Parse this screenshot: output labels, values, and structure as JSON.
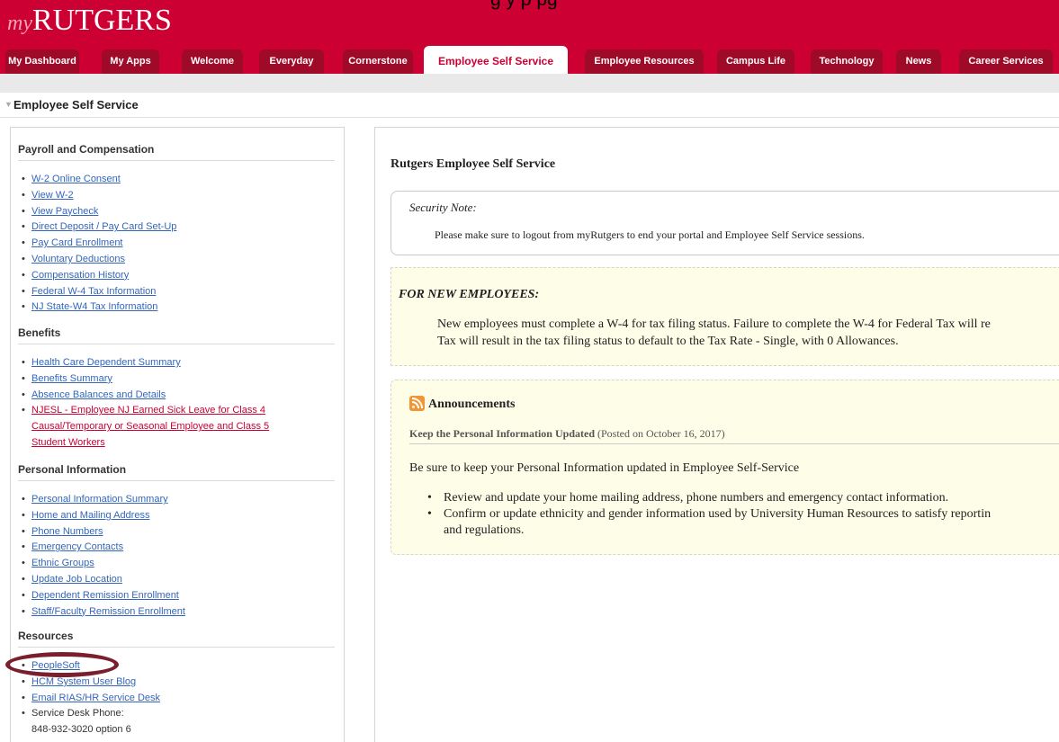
{
  "overlay_caption": "g y                 p                         pg",
  "logo": {
    "my": "my",
    "name": "RUTGERS"
  },
  "tabs": [
    {
      "label": "My Dashboard"
    },
    {
      "label": "My Apps"
    },
    {
      "label": "Welcome"
    },
    {
      "label": "Everyday"
    },
    {
      "label": "Cornerstone"
    },
    {
      "label": "Employee Self Service",
      "active": true
    },
    {
      "label": "Employee Resources"
    },
    {
      "label": "Campus Life"
    },
    {
      "label": "Technology"
    },
    {
      "label": "News"
    },
    {
      "label": "Career Services"
    }
  ],
  "section_title": "Employee Self Service",
  "left": {
    "payroll": {
      "title": "Payroll and Compensation",
      "links": [
        "W-2 Online Consent",
        "View W-2",
        "View Paycheck",
        "Direct Deposit / Pay Card Set-Up",
        "Pay Card Enrollment",
        "Voluntary Deductions",
        "Compensation History",
        "Federal W-4 Tax Information",
        "NJ State-W4 Tax Information"
      ]
    },
    "benefits": {
      "title": "Benefits",
      "links": [
        "Health Care Dependent Summary",
        "Benefits Summary",
        "Absence Balances and Details"
      ],
      "njesl": [
        "NJESL - Employee NJ Earned Sick Leave for Class 4",
        "Causal/Temporary or Seasonal Employee and Class 5",
        "Student Workers"
      ]
    },
    "personal": {
      "title": "Personal Information",
      "links": [
        "Personal Information Summary",
        "Home and Mailing Address",
        "Phone Numbers",
        "Emergency Contacts",
        "Ethnic Groups",
        "Update Job Location",
        "Dependent Remission Enrollment",
        "Staff/Faculty Remission Enrollment"
      ]
    },
    "resources": {
      "title": "Resources",
      "links": [
        "PeopleSoft",
        "HCM System User Blog",
        "Email RIAS/HR Service Desk"
      ],
      "phone_label": "Service Desk Phone:",
      "phone_number": "848-932-3020 option 6"
    }
  },
  "right": {
    "title": "Rutgers Employee Self Service",
    "security": {
      "label": "Security Note:",
      "message": "Please make sure to logout from myRutgers to end your portal and Employee Self Service sessions."
    },
    "new_employees": {
      "label": "FOR NEW EMPLOYEES:",
      "line1": "New employees must complete a W-4 for tax filing status. Failure to complete the W-4 for Federal Tax will re",
      "line2": "Tax will result in the tax filing status to default to the Tax Rate - Single, with 0 Allowances."
    },
    "announcements": {
      "title": "Announcements",
      "item_title": "Keep the Personal Information Updated",
      "posted": "(Posted on October 16, 2017)",
      "body": "Be sure to keep your Personal Information updated in Employee Self-Service",
      "bullets": [
        "Review and update your home mailing address, phone numbers and emergency contact information.",
        "Confirm or update ethnicity and gender information used by University Human Resources to satisfy reportin",
        "and regulations."
      ]
    }
  },
  "colors": {
    "brand_red": "#cc0033",
    "tab_dark": "#9f0a28",
    "link_blue": "#3366bb",
    "highlight_circle": "#7a1f2e",
    "notice_bg": "#fdfde8"
  }
}
